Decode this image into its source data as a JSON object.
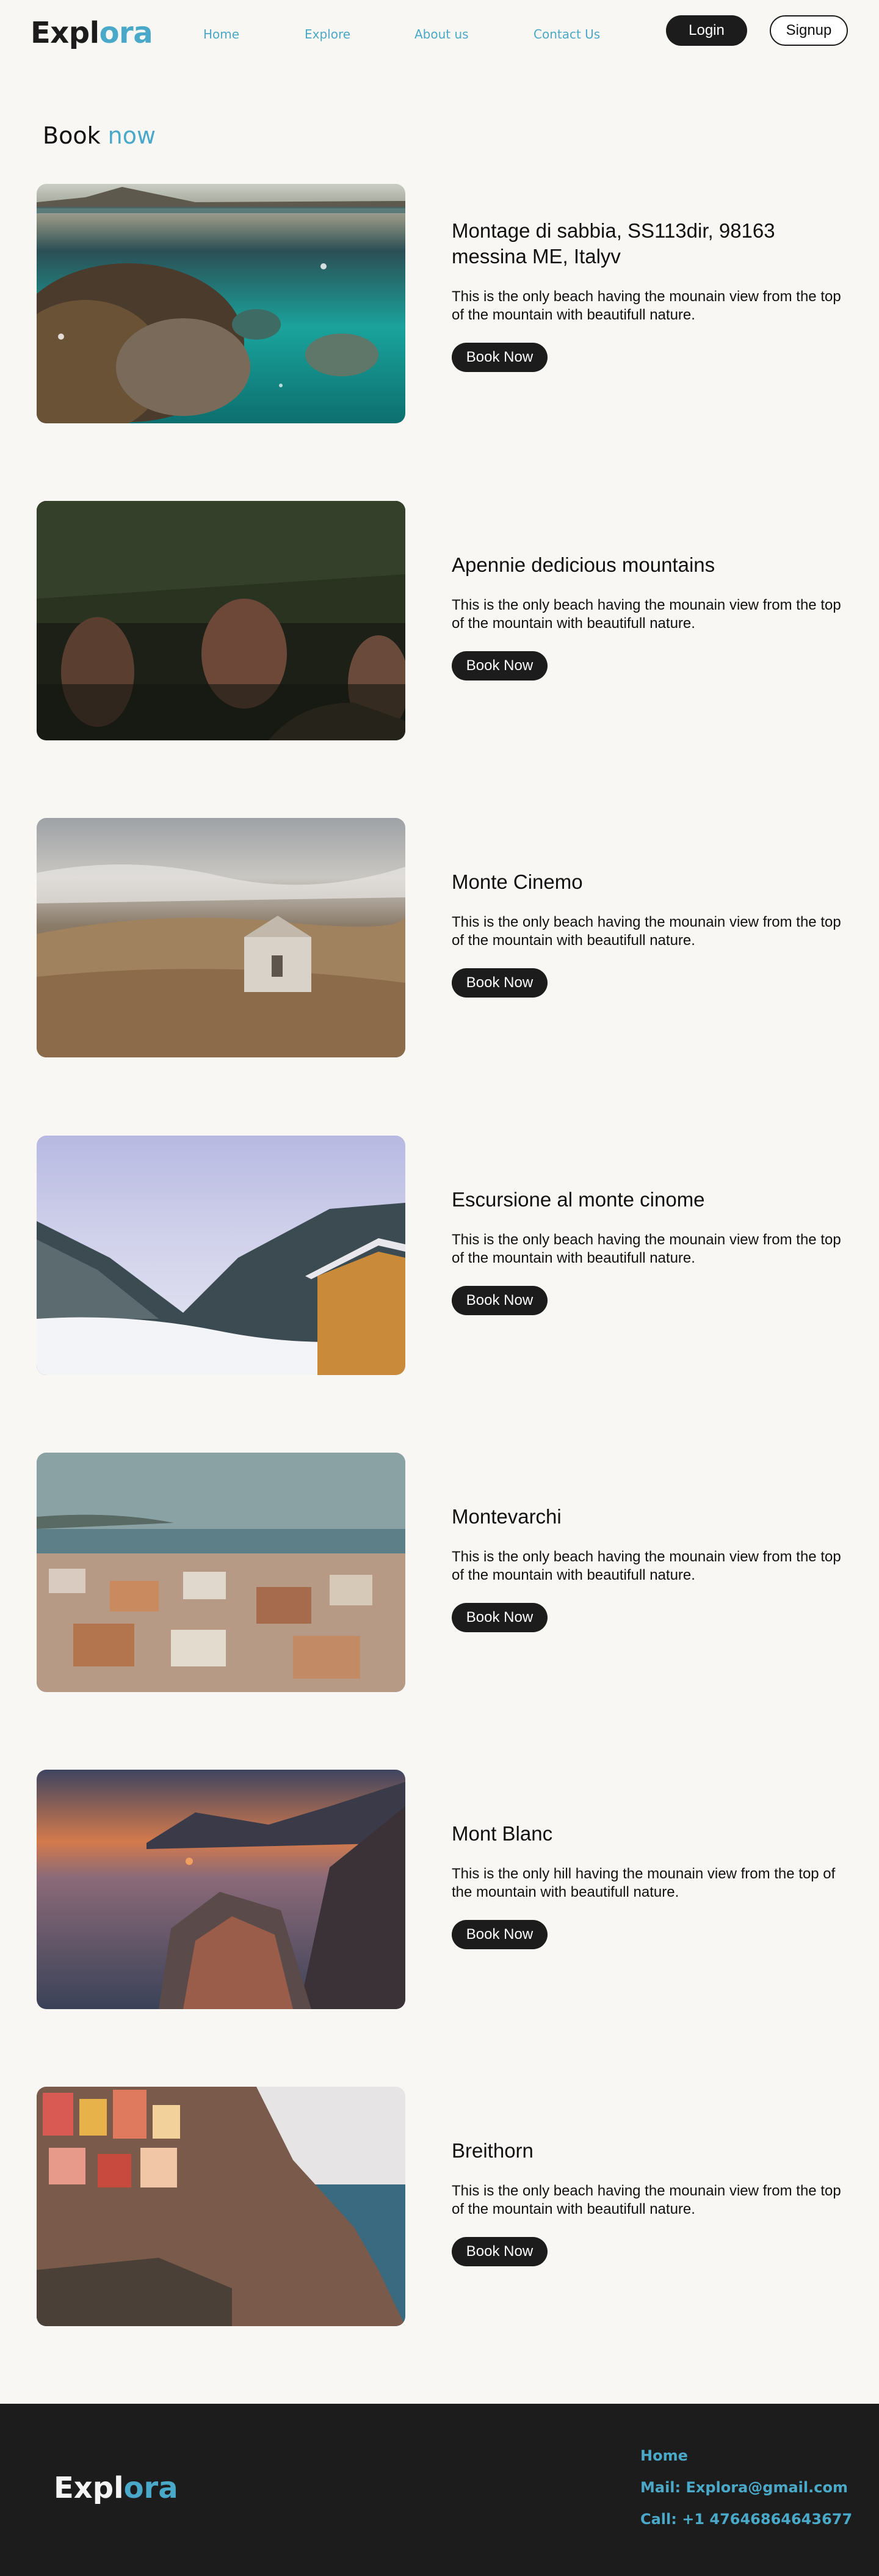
{
  "header": {
    "logo_part1": "Expl",
    "logo_part2": "ora",
    "nav": [
      "Home",
      "Explore",
      "About us",
      "Contact Us"
    ],
    "login_label": "Login",
    "signup_label": "Signup"
  },
  "page": {
    "title_part1": "Book",
    "title_part2": "now"
  },
  "destinations": [
    {
      "title": "Montage di sabbia, SS113dir, 98163 messina ME, Italyv",
      "description": "This is the only beach having the mounain view from the top of the mountain with beautifull nature.",
      "button": "Book Now",
      "image": "underwater-beach-photo"
    },
    {
      "title": "Apennie dedicious mountains",
      "description": "This is the only beach having the mounain view from the top of the mountain with beautifull nature.",
      "button": "Book Now",
      "image": "forest-photo"
    },
    {
      "title": "Monte Cinemo",
      "description": "This is the only beach having the mounain view from the top of the mountain with beautifull nature.",
      "button": "Book Now",
      "image": "hilltop-chapel-photo"
    },
    {
      "title": "Escursione al monte cinome",
      "description": "This is the only beach having the mounain view from the top of the mountain with beautifull nature.",
      "button": "Book Now",
      "image": "snowy-mountain-hut-photo"
    },
    {
      "title": "Montevarchi",
      "description": "This is the only beach having the mounain view from the top of the mountain with beautifull nature.",
      "button": "Book Now",
      "image": "coastal-town-photo"
    },
    {
      "title": "Mont Blanc",
      "description": "This is the only hill having the mounain view from the top of the mountain with beautifull nature.",
      "button": "Book Now",
      "image": "sunset-cliff-village-photo"
    },
    {
      "title": "Breithorn",
      "description": "This is the only beach having the mounain view from the top of the mountain with beautifull nature.",
      "button": "Book Now",
      "image": "colorful-cliff-houses-photo"
    }
  ],
  "footer": {
    "logo_part1": "Expl",
    "logo_part2": "ora",
    "home": "Home",
    "mail": "Mail: Explora@gmail.com",
    "call": "Call: +1 47646864643677"
  },
  "colors": {
    "accent": "#4aa8c8",
    "dark": "#1c1c1c",
    "background": "#f9f7f3"
  }
}
